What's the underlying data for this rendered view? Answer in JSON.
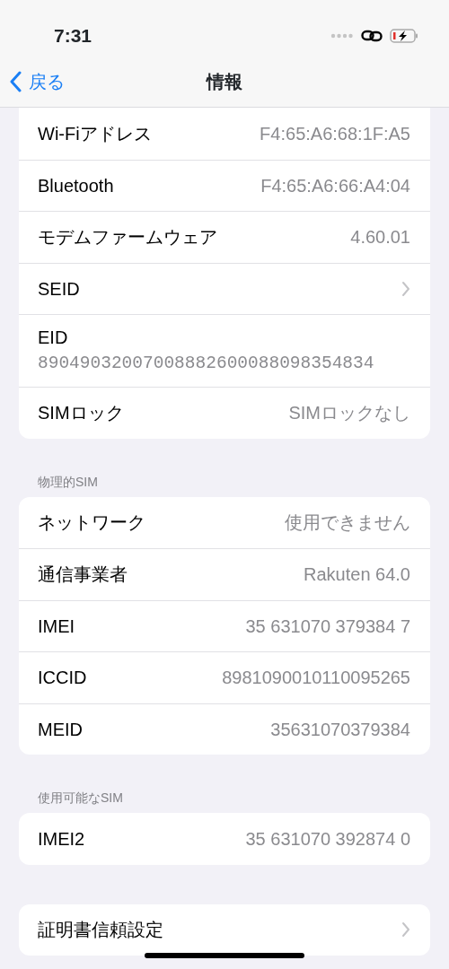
{
  "status_bar": {
    "time": "7:31"
  },
  "nav": {
    "back": "戻る",
    "title": "情報"
  },
  "sections": [
    {
      "rows": [
        {
          "kind": "value",
          "label": "Wi-Fiアドレス",
          "value": "F4:65:A6:68:1F:A5"
        },
        {
          "kind": "value",
          "label": "Bluetooth",
          "value": "F4:65:A6:66:A4:04"
        },
        {
          "kind": "value",
          "label": "モデムファームウェア",
          "value": "4.60.01"
        },
        {
          "kind": "chevron",
          "label": "SEID"
        },
        {
          "kind": "stacked",
          "label": "EID",
          "value": "89049032007008882600088098354834"
        },
        {
          "kind": "value",
          "label": "SIMロック",
          "value": "SIMロックなし"
        }
      ]
    },
    {
      "header": "物理的SIM",
      "rows": [
        {
          "kind": "value",
          "label": "ネットワーク",
          "value": "使用できません"
        },
        {
          "kind": "value",
          "label": "通信事業者",
          "value": "Rakuten 64.0"
        },
        {
          "kind": "value",
          "label": "IMEI",
          "value": "35 631070 379384 7"
        },
        {
          "kind": "value",
          "label": "ICCID",
          "value": "8981090010110095265"
        },
        {
          "kind": "value",
          "label": "MEID",
          "value": "35631070379384"
        }
      ]
    },
    {
      "header": "使用可能なSIM",
      "rows": [
        {
          "kind": "value",
          "label": "IMEI2",
          "value": "35 631070 392874 0"
        }
      ]
    },
    {
      "rows": [
        {
          "kind": "chevron",
          "label": "証明書信頼設定"
        }
      ]
    }
  ]
}
